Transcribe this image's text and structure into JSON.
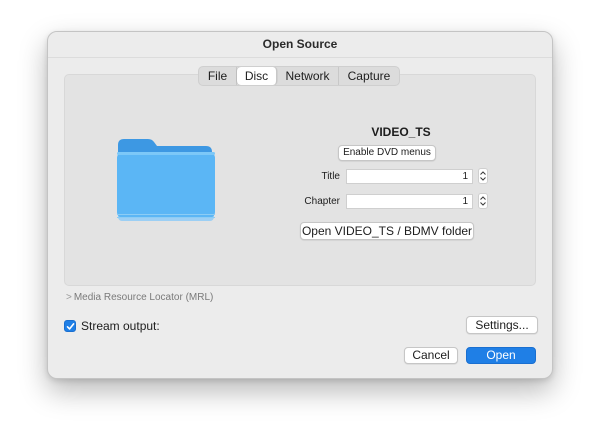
{
  "window": {
    "title": "Open Source"
  },
  "tabs": [
    {
      "label": "File",
      "active": false
    },
    {
      "label": "Disc",
      "active": true
    },
    {
      "label": "Network",
      "active": false
    },
    {
      "label": "Capture",
      "active": false
    }
  ],
  "disc": {
    "name": "VIDEO_TS",
    "dvd_menus_button": "Enable DVD menus",
    "title_label": "Title",
    "title_value": "1",
    "chapter_label": "Chapter",
    "chapter_value": "1",
    "open_folder_button": "Open VIDEO_TS / BDMV folder"
  },
  "mrl": {
    "chevron": ">",
    "label": "Media Resource Locator (MRL)"
  },
  "stream_output": {
    "label": "Stream output:",
    "checked": true,
    "settings_button": "Settings..."
  },
  "footer": {
    "cancel_label": "Cancel",
    "open_label": "Open"
  },
  "colors": {
    "accent": "#1f7fe6",
    "folder_front": "#5bb6f5",
    "folder_back": "#3d98e3",
    "window_bg": "#ececec"
  }
}
